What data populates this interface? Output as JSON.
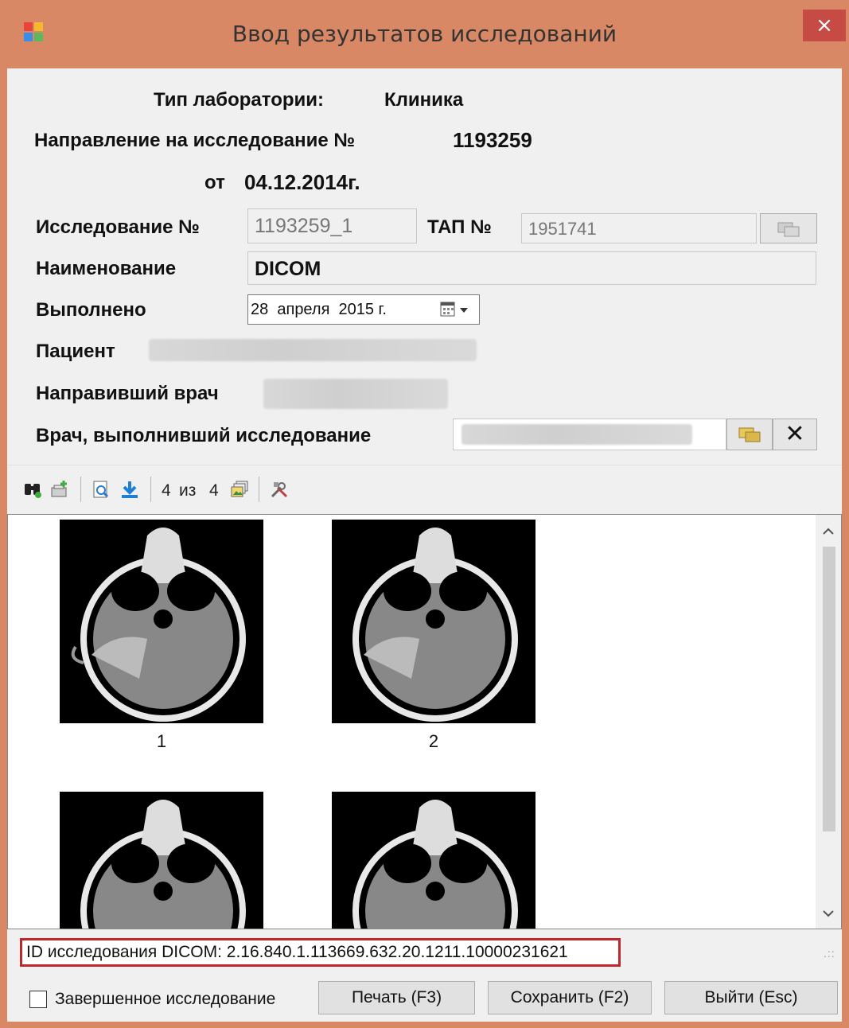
{
  "window": {
    "title": "Ввод результатов исследований",
    "close_glyph": "×"
  },
  "header": {
    "lab_type_label": "Тип лаборатории:",
    "lab_type_value": "Клиника",
    "referral_label": "Направление на исследование №",
    "referral_number": "1193259",
    "date_prefix": "от",
    "date_value": "04.12.2014г."
  },
  "form": {
    "study_number_label": "Исследование №",
    "study_number_value": "1193259_1",
    "tap_label": "ТАП №",
    "tap_value": "1951741",
    "name_label": "Наименование",
    "name_value": "DICOM",
    "done_label": "Выполнено",
    "done_date": "28  апреля  2015 г.",
    "patient_label": "Пациент",
    "referring_doctor_label": "Направивший врач",
    "performing_doctor_label": "Врач, выполнивший исследование",
    "clear_glyph": "✕"
  },
  "toolbar": {
    "page_current": "4",
    "page_sep": "из",
    "page_total": "4",
    "icons": [
      "binoculars-icon",
      "add-image-icon",
      "preview-icon",
      "download-icon",
      "gallery-icon",
      "tools-icon"
    ]
  },
  "images": [
    {
      "label": "1"
    },
    {
      "label": "2"
    },
    {
      "label": ""
    },
    {
      "label": ""
    }
  ],
  "status": {
    "dicom_id_text": "ID исследования DICOM: 2.16.840.1.113669.632.20.1211.10000231621"
  },
  "footer": {
    "completed_label": "Завершенное исследование",
    "completed_checked": false,
    "print_label": "Печать (F3)",
    "save_label": "Сохранить (F2)",
    "exit_label": "Выйти (Esc)"
  },
  "colors": {
    "title_bar": "#d98866",
    "close_button": "#c74b45",
    "highlight_border": "#c0272d",
    "client_bg": "#f0f0f0"
  }
}
